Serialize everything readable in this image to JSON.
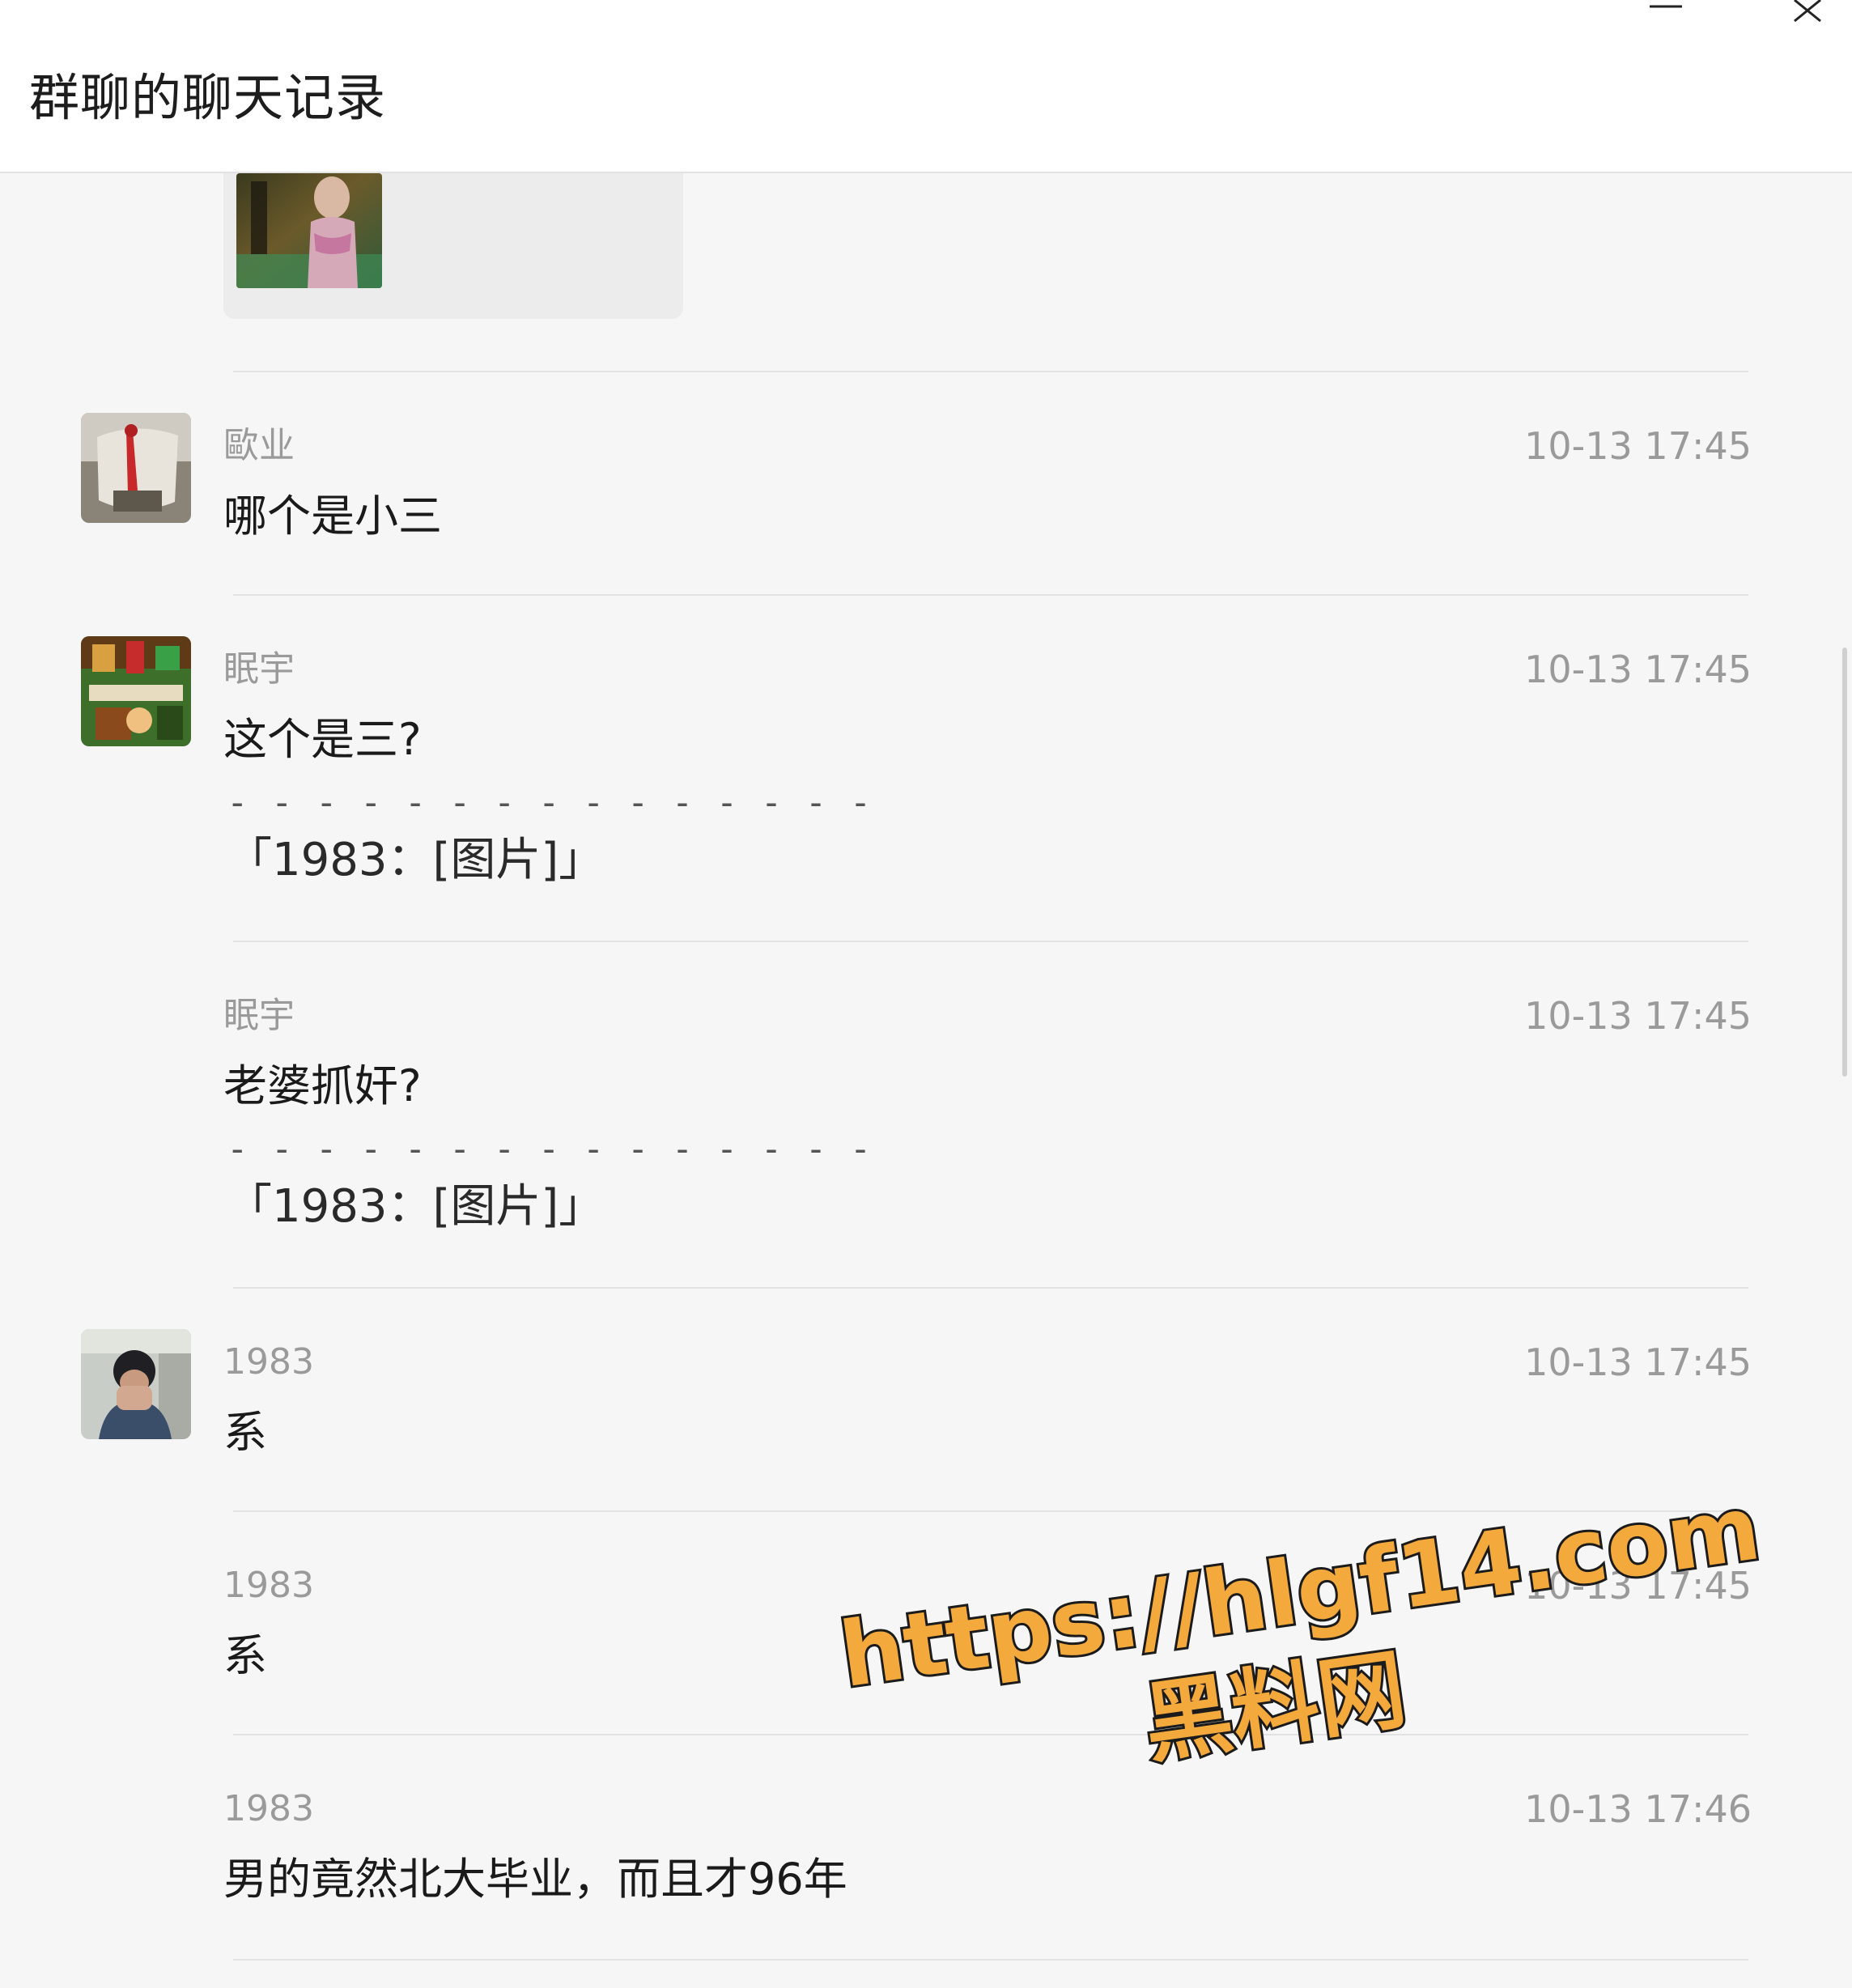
{
  "window": {
    "title": "群聊的聊天记录",
    "minimize_icon": "minimize-icon",
    "close_icon": "close-icon"
  },
  "messages": [
    {
      "sender": "歐业",
      "time": "10-13 17:45",
      "text": "哪个是小三",
      "avatar": "avatar-red-ribbon"
    },
    {
      "sender": "眠宇",
      "time": "10-13 17:45",
      "text": "这个是三?",
      "quote_separator": "- - - - - - - - - - - - - - -",
      "quote": "「1983：[图片]」",
      "avatar": "avatar-game-scene"
    },
    {
      "sender": "眠宇",
      "time": "10-13 17:45",
      "text": "老婆抓奸?",
      "quote_separator": "- - - - - - - - - - - - - - -",
      "quote": "「1983：[图片]」"
    },
    {
      "sender": "1983",
      "time": "10-13 17:45",
      "text": "系",
      "avatar": "avatar-person-photo"
    },
    {
      "sender": "1983",
      "time": "10-13 17:45",
      "text": "系"
    },
    {
      "sender": "1983",
      "time": "10-13 17:46",
      "text": "男的竟然北大毕业，而且才96年"
    }
  ],
  "watermark": {
    "url": "https://hlgf14.com",
    "brand": "黑料网"
  },
  "colors": {
    "background": "#f6f6f6",
    "header": "#ffffff",
    "meta_text": "#9a9a9a",
    "watermark_fill": "#f3a93c"
  }
}
